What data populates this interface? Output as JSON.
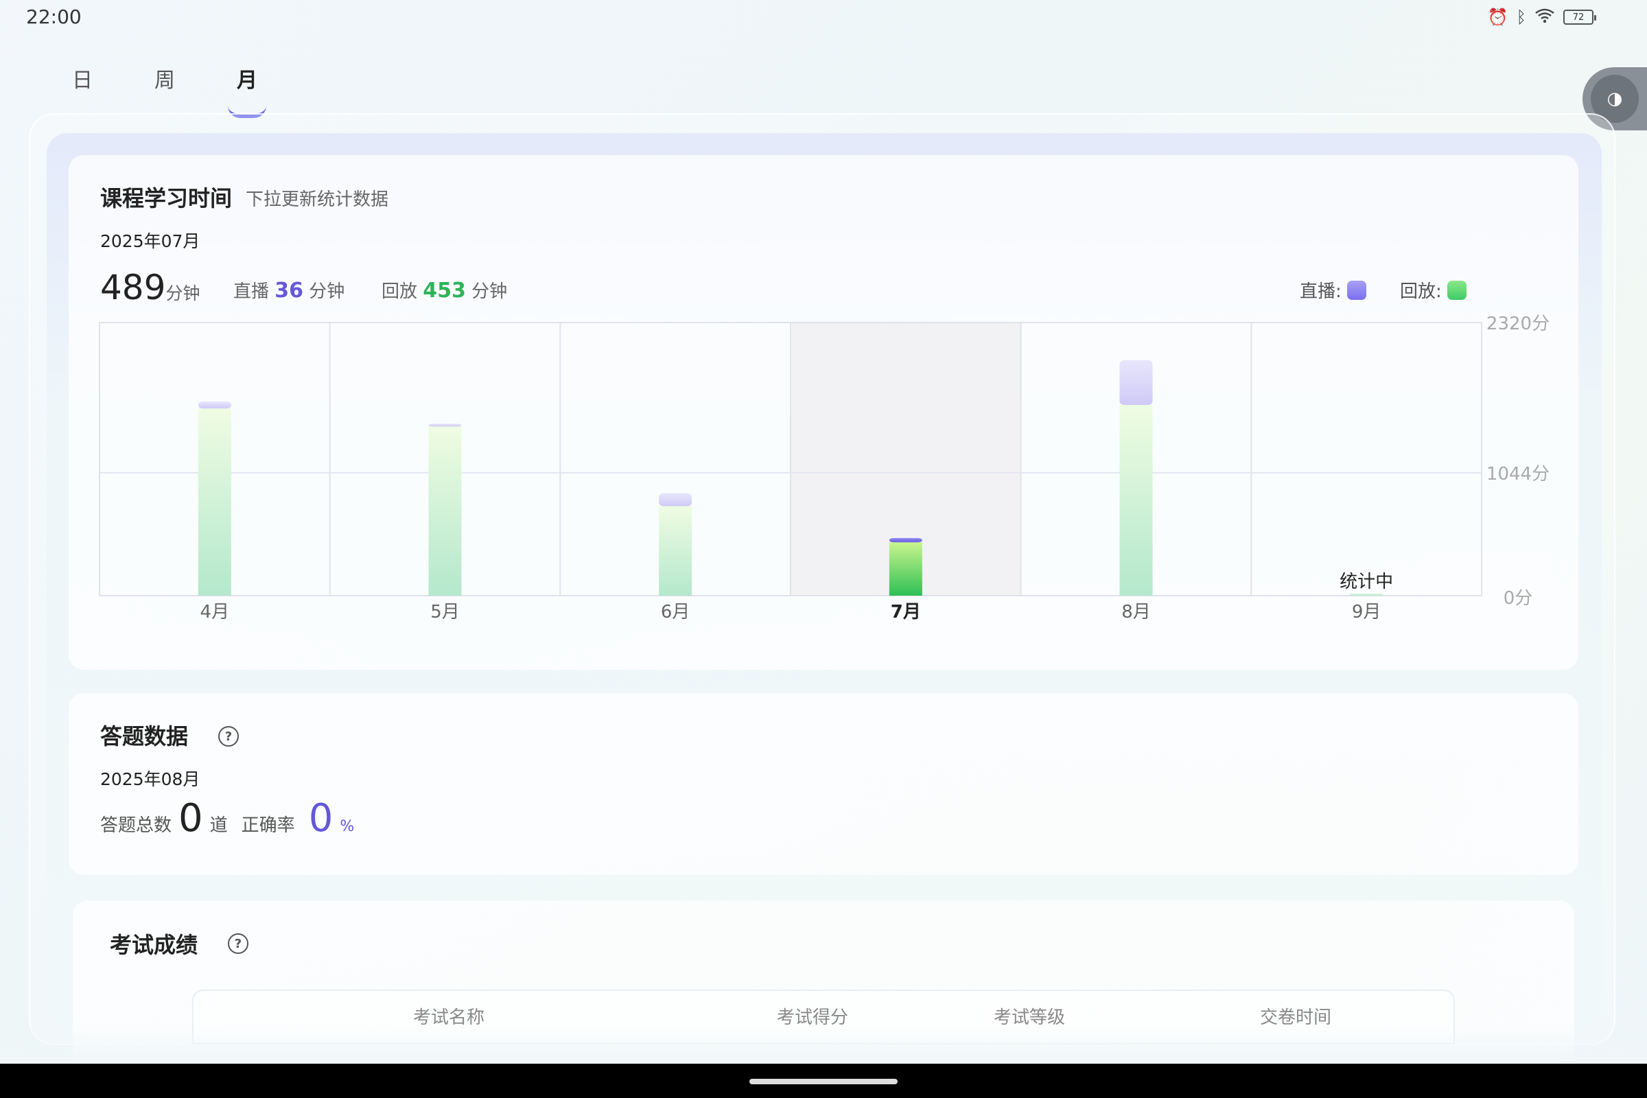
{
  "status_bar": {
    "time": "22:00",
    "battery": "72"
  },
  "tabs": [
    {
      "label": "日"
    },
    {
      "label": "周"
    },
    {
      "label": "月"
    }
  ],
  "study_time": {
    "title": "课程学习时间",
    "subtitle": "下拉更新统计数据",
    "month": "2025年07月",
    "total": "489",
    "total_unit": "分钟",
    "live_label": "直播",
    "live_value": "36",
    "live_unit": "分钟",
    "replay_label": "回放",
    "replay_value": "453",
    "replay_unit": "分钟",
    "legend_live": "直播:",
    "legend_replay": "回放:",
    "colors": {
      "live": "#7b6ff0",
      "replay": "#44d06a"
    }
  },
  "chart_data": {
    "type": "bar",
    "stacked": true,
    "categories": [
      "4月",
      "5月",
      "6月",
      "7月",
      "8月",
      "9月"
    ],
    "selected": "7月",
    "series": [
      {
        "name": "回放",
        "values": [
          1590,
          1440,
          760,
          453,
          1620,
          20
        ]
      },
      {
        "name": "直播",
        "values": [
          60,
          20,
          110,
          36,
          380,
          0
        ]
      }
    ],
    "y_ticks": [
      "0分",
      "1044分",
      "2320分"
    ],
    "ylim": [
      0,
      2320
    ],
    "annotation": {
      "category": "9月",
      "text": "统计中"
    }
  },
  "answers": {
    "title": "答题数据",
    "month": "2025年08月",
    "total_label": "答题总数",
    "total_value": "0",
    "total_unit": "道",
    "accuracy_label": "正确率",
    "accuracy_value": "0",
    "accuracy_unit": "%"
  },
  "exams": {
    "title": "考试成绩",
    "columns": [
      "考试名称",
      "考试得分",
      "考试等级",
      "交卷时间"
    ]
  }
}
